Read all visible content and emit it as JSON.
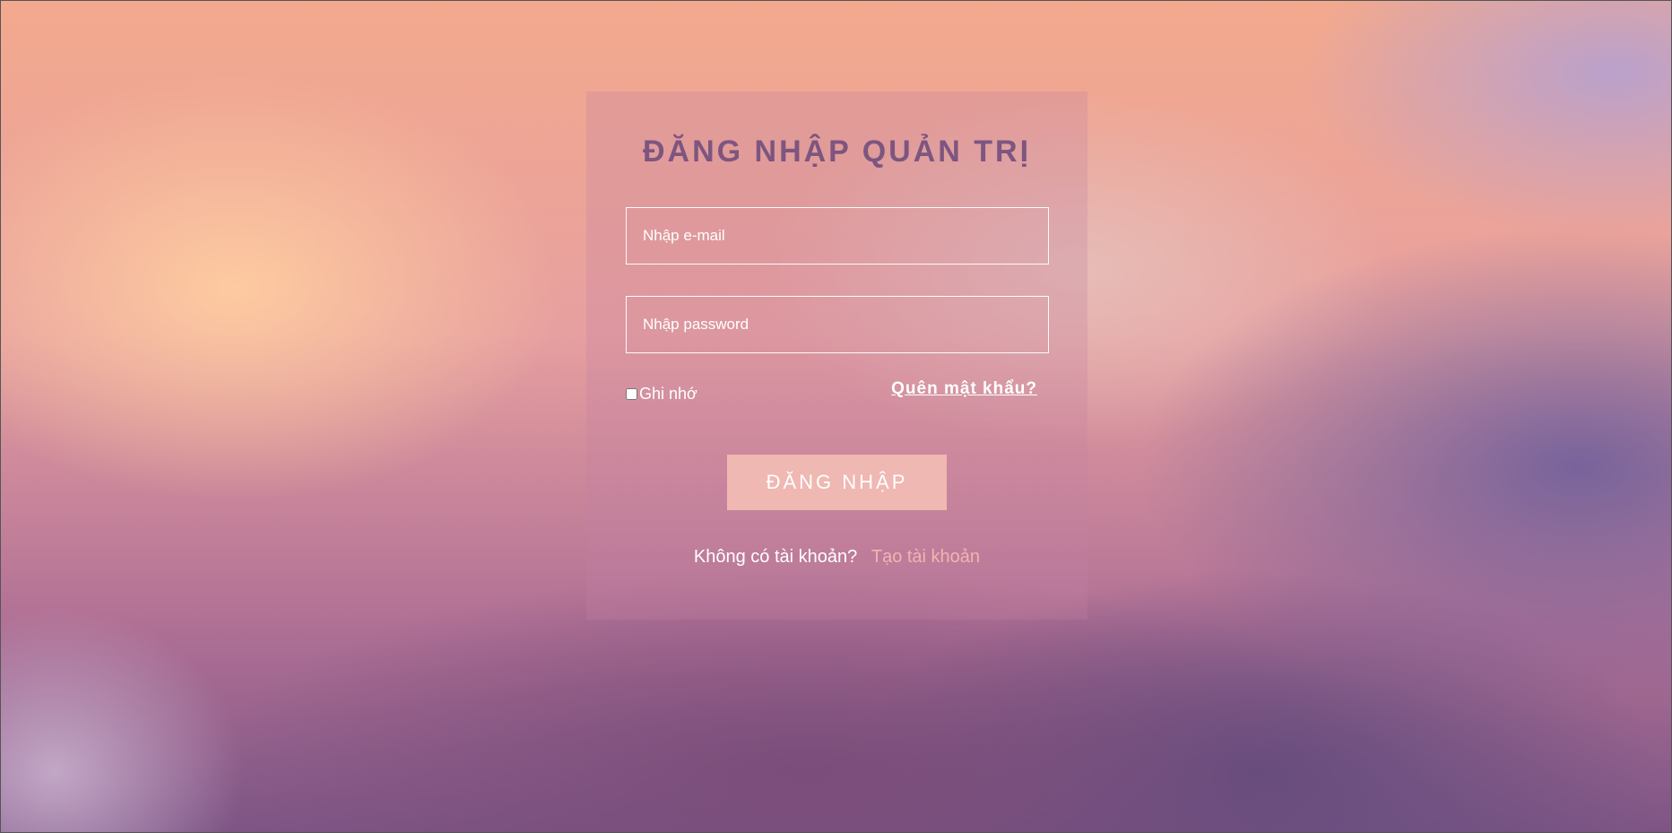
{
  "login": {
    "title": "ĐĂNG NHẬP QUẢN TRỊ",
    "email_placeholder": "Nhập e-mail",
    "email_value": "",
    "password_placeholder": "Nhập password",
    "password_value": "",
    "remember_label": "Ghi nhớ",
    "remember_checked": false,
    "forgot_label": "Quên mật khẩu?",
    "submit_label": "ĐĂNG NHẬP",
    "signup_prompt": "Không có tài khoản?",
    "signup_link": "Tạo tài khoản"
  },
  "colors": {
    "title": "#7d5580",
    "button": "#efb8b2",
    "signup_link": "#f2b4b2",
    "text": "#ffffff"
  }
}
